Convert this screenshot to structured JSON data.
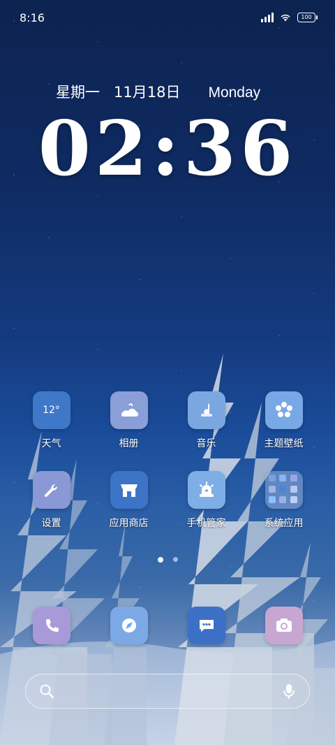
{
  "status": {
    "time": "8:16",
    "battery": "100"
  },
  "clock": {
    "weekday_cn": "星期一",
    "date_cn": "11月18日",
    "weekday_en": "Monday",
    "time": "02:36"
  },
  "apps": [
    {
      "label": "天气",
      "icon": "weather-icon",
      "bg": "#3f78c9",
      "icon_text": "12°"
    },
    {
      "label": "相册",
      "icon": "gallery-icon",
      "bg": "#8a9ed8"
    },
    {
      "label": "音乐",
      "icon": "music-icon",
      "bg": "#7aa7e0"
    },
    {
      "label": "主题壁纸",
      "icon": "theme-icon",
      "bg": "#78a8e6"
    },
    {
      "label": "设置",
      "icon": "settings-icon",
      "bg": "#8b98d6"
    },
    {
      "label": "应用商店",
      "icon": "app-store-icon",
      "bg": "#3c74c8"
    },
    {
      "label": "手机管家",
      "icon": "security-icon",
      "bg": "#7eaee6"
    },
    {
      "label": "系统应用",
      "icon": "folder-icon",
      "bg": "rgba(170,190,230,0.45)"
    }
  ],
  "dock": [
    {
      "icon": "phone-icon",
      "bg": "#a89ad8"
    },
    {
      "icon": "browser-icon",
      "bg": "#7ca8e6"
    },
    {
      "icon": "messages-icon",
      "bg": "#3b70c6"
    },
    {
      "icon": "camera-icon",
      "bg": "#c7a7d2"
    }
  ],
  "pager": {
    "active_index": 0,
    "count": 2
  }
}
